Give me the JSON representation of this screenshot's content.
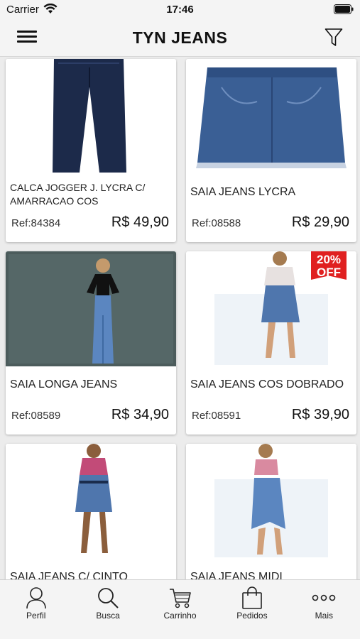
{
  "status_bar": {
    "carrier": "Carrier",
    "time": "17:46"
  },
  "nav": {
    "title": "TYN JEANS",
    "menu_icon": "hamburger-menu-icon",
    "filter_icon": "filter-funnel-icon"
  },
  "products": [
    {
      "name": "CALCA JOGGER J. LYCRA C/ AMARRACAO COS",
      "ref": "Ref:84384",
      "price": "R$ 49,90"
    },
    {
      "name": "SAIA JEANS LYCRA",
      "ref": "Ref:08588",
      "price": "R$ 29,90"
    },
    {
      "name": "SAIA LONGA JEANS",
      "ref": "Ref:08589",
      "price": "R$ 34,90"
    },
    {
      "name": "SAIA JEANS COS DOBRADO",
      "ref": "Ref:08591",
      "price": "R$ 39,90",
      "badge": "20% OFF"
    },
    {
      "name": "SAIA JEANS C/ CINTO",
      "ref": "",
      "price": ""
    },
    {
      "name": "SAIA JEANS MIDI",
      "ref": "",
      "price": ""
    }
  ],
  "tabs": [
    {
      "label": "Perfil",
      "icon": "person-icon"
    },
    {
      "label": "Busca",
      "icon": "search-icon"
    },
    {
      "label": "Carrinho",
      "icon": "cart-icon"
    },
    {
      "label": "Pedidos",
      "icon": "shopping-bag-icon"
    },
    {
      "label": "Mais",
      "icon": "more-dots-icon"
    }
  ],
  "colors": {
    "badge_red": "#e02020",
    "denim": "#3a5f95",
    "dark_denim": "#1c2a4a"
  }
}
